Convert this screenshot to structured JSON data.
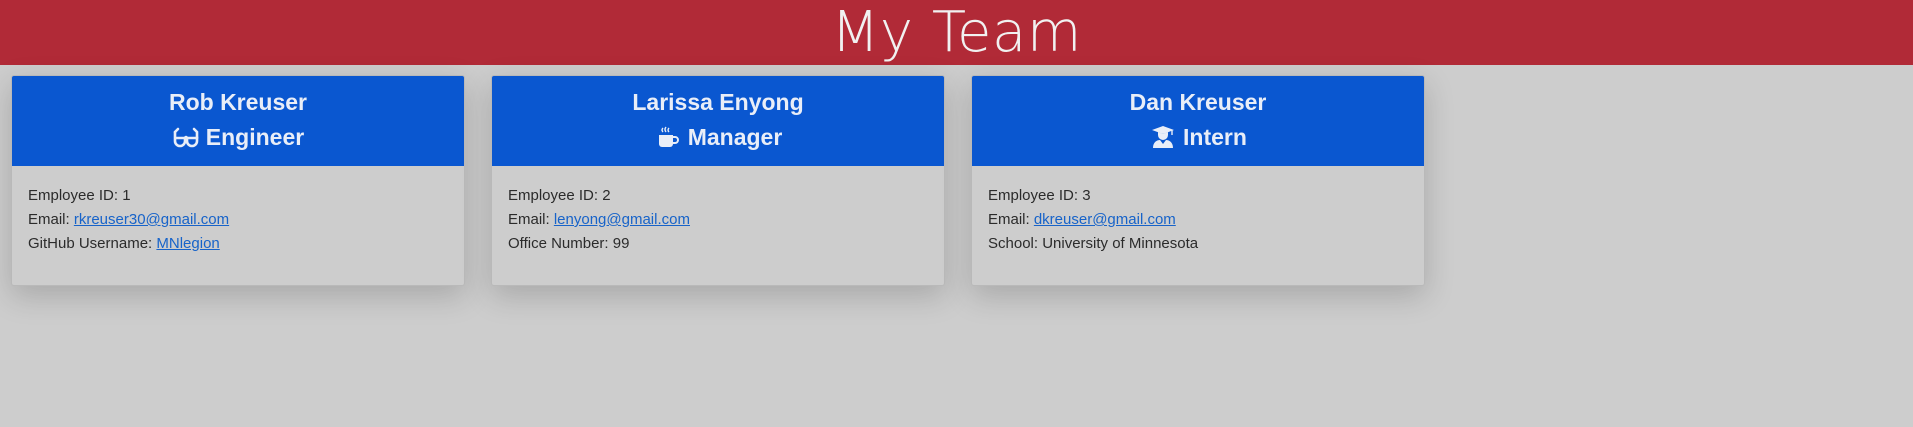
{
  "page": {
    "title": "My Team"
  },
  "colors": {
    "header_bg": "#b12a37",
    "card_head_bg": "#0a57d0",
    "background": "#cdcdcd",
    "link": "#1763c9"
  },
  "employees": [
    {
      "name": "Rob Kreuser",
      "role": "Engineer",
      "role_icon": "glasses-icon",
      "id_label": "Employee ID: ",
      "id": "1",
      "email_label": "Email: ",
      "email": "rkreuser30@gmail.com",
      "extra_label": "GitHub Username: ",
      "extra_value": "MNlegion"
    },
    {
      "name": "Larissa Enyong",
      "role": "Manager",
      "role_icon": "mug-icon",
      "id_label": "Employee ID: ",
      "id": "2",
      "email_label": "Email: ",
      "email": "lenyong@gmail.com",
      "extra_label": "Office Number: ",
      "extra_value": "99"
    },
    {
      "name": "Dan Kreuser",
      "role": "Intern",
      "role_icon": "graduate-icon",
      "id_label": "Employee ID: ",
      "id": "3",
      "email_label": "Email: ",
      "email": "dkreuser@gmail.com",
      "extra_label": "School: ",
      "extra_value": "University of Minnesota"
    }
  ]
}
